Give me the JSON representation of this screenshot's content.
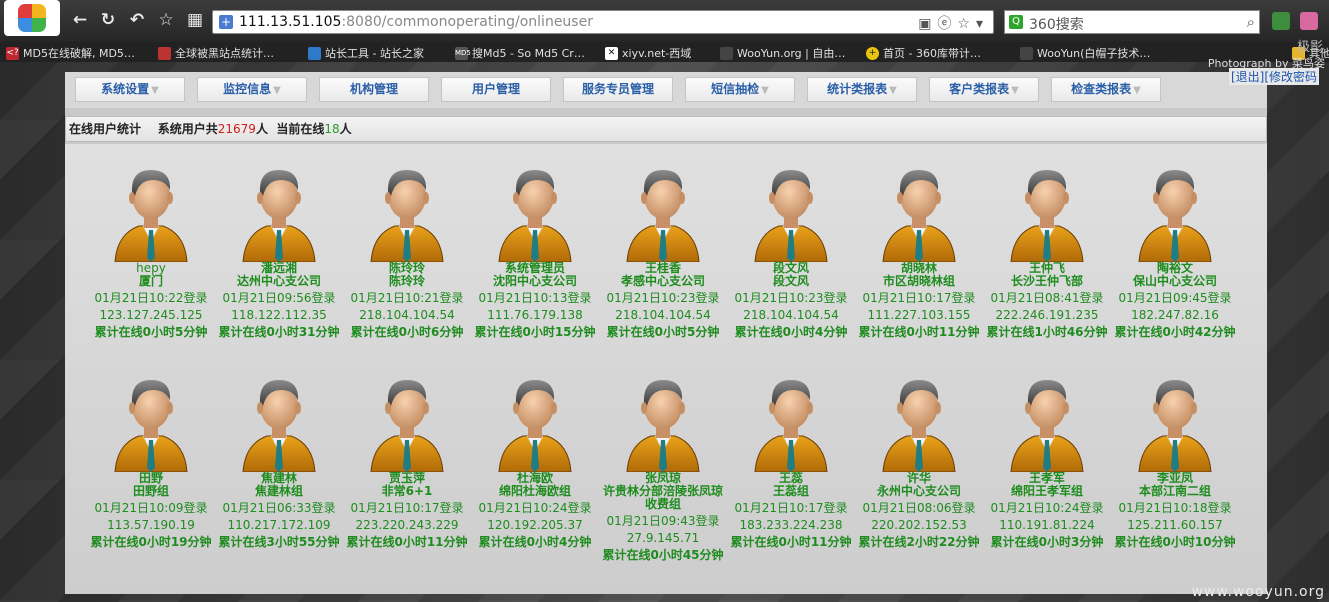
{
  "browser": {
    "url_host": "111.13.51.105",
    "url_path": ":8080/commonoperating/onlineuser",
    "search_placeholder": "360搜索",
    "bookmarks": [
      "MD5在线破解, MD5…",
      "全球被黑站点统计…",
      "站长工具 - 站长之家",
      "搜Md5 - So Md5 Cr…",
      "xiyv.net-西域",
      "WooYun.org | 自由…",
      "首页 - 360库带计…",
      "WooYun(白帽子技术…",
      "其他"
    ],
    "photo_credit": "Photograph by 菜鸟姿",
    "brand_text": "极影"
  },
  "menu": {
    "items": [
      {
        "label": "系统设置",
        "has_arrow": true
      },
      {
        "label": "监控信息",
        "has_arrow": true
      },
      {
        "label": "机构管理",
        "has_arrow": false
      },
      {
        "label": "用户管理",
        "has_arrow": false
      },
      {
        "label": "服务专员管理",
        "has_arrow": false
      },
      {
        "label": "短信抽检",
        "has_arrow": true
      },
      {
        "label": "统计类报表",
        "has_arrow": true
      },
      {
        "label": "客户类报表",
        "has_arrow": true
      },
      {
        "label": "检查类报表",
        "has_arrow": true
      }
    ],
    "arrow_glyph": "▼"
  },
  "auth": {
    "logout": "[退出]",
    "change_password": "[修改密码"
  },
  "stats": {
    "title": "在线用户统计",
    "total_prefix": "系统用户共",
    "total_count": "21679",
    "total_suffix": "人",
    "online_prefix": "当前在线",
    "online_count": "18",
    "online_suffix": "人"
  },
  "users": [
    {
      "name": "hepy",
      "org": "厦门",
      "login": "01月21日10:22登录",
      "ip": "123.127.245.125",
      "online": "累计在线0小时5分钟",
      "name_light": true
    },
    {
      "name": "潘远湘",
      "org": "达州中心支公司",
      "login": "01月21日09:56登录",
      "ip": "118.122.112.35",
      "online": "累计在线0小时31分钟"
    },
    {
      "name": "陈玲玲",
      "org": "陈玲玲",
      "login": "01月21日10:21登录",
      "ip": "218.104.104.54",
      "online": "累计在线0小时6分钟"
    },
    {
      "name": "系统管理员",
      "org": "沈阳中心支公司",
      "login": "01月21日10:13登录",
      "ip": "111.76.179.138",
      "online": "累计在线0小时15分钟"
    },
    {
      "name": "王桂香",
      "org": "孝感中心支公司",
      "login": "01月21日10:23登录",
      "ip": "218.104.104.54",
      "online": "累计在线0小时5分钟"
    },
    {
      "name": "段文风",
      "org": "段文风",
      "login": "01月21日10:23登录",
      "ip": "218.104.104.54",
      "online": "累计在线0小时4分钟"
    },
    {
      "name": "胡晓林",
      "org": "市区胡晓林组",
      "login": "01月21日10:17登录",
      "ip": "111.227.103.155",
      "online": "累计在线0小时11分钟"
    },
    {
      "name": "王仲飞",
      "org": "长沙王仲飞部",
      "login": "01月21日08:41登录",
      "ip": "222.246.191.235",
      "online": "累计在线1小时46分钟"
    },
    {
      "name": "陶裕文",
      "org": "保山中心支公司",
      "login": "01月21日09:45登录",
      "ip": "182.247.82.16",
      "online": "累计在线0小时42分钟"
    },
    {
      "name": "田野",
      "org": "田野组",
      "login": "01月21日10:09登录",
      "ip": "113.57.190.19",
      "online": "累计在线0小时19分钟"
    },
    {
      "name": "焦建林",
      "org": "焦建林组",
      "login": "01月21日06:33登录",
      "ip": "110.217.172.109",
      "online": "累计在线3小时55分钟"
    },
    {
      "name": "贾玉萍",
      "org": "非常6+1",
      "login": "01月21日10:17登录",
      "ip": "223.220.243.229",
      "online": "累计在线0小时11分钟"
    },
    {
      "name": "杜海欧",
      "org": "绵阳杜海欧组",
      "login": "01月21日10:24登录",
      "ip": "120.192.205.37",
      "online": "累计在线0小时4分钟"
    },
    {
      "name": "张凤琼",
      "org": "许贵林分部涪陵张凤琼收费组",
      "login": "01月21日09:43登录",
      "ip": "27.9.145.71",
      "online": "累计在线0小时45分钟"
    },
    {
      "name": "王蕊",
      "org": "王蕊组",
      "login": "01月21日10:17登录",
      "ip": "183.233.224.238",
      "online": "累计在线0小时11分钟"
    },
    {
      "name": "许华",
      "org": "永州中心支公司",
      "login": "01月21日08:06登录",
      "ip": "220.202.152.53",
      "online": "累计在线2小时22分钟"
    },
    {
      "name": "王孝军",
      "org": "绵阳王孝军组",
      "login": "01月21日10:24登录",
      "ip": "110.191.81.224",
      "online": "累计在线0小时3分钟"
    },
    {
      "name": "李亚凤",
      "org": "本部江南二组",
      "login": "01月21日10:18登录",
      "ip": "125.211.60.157",
      "online": "累计在线0小时10分钟"
    }
  ],
  "watermark": "www.wooyun.org"
}
